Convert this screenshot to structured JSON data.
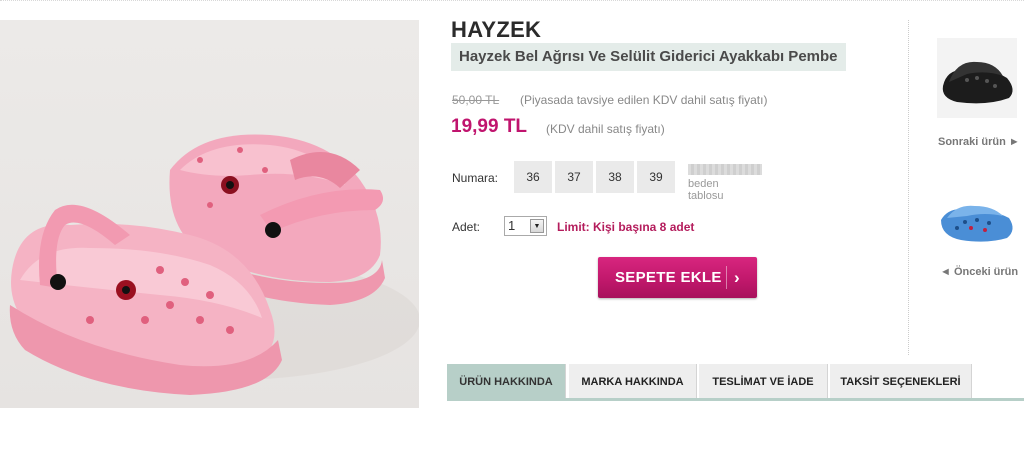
{
  "product": {
    "brand": "HAYZEK",
    "title": "Hayzek Bel Ağrısı Ve Selülit Giderici Ayakkabı Pembe",
    "old_price": "50,00 TL",
    "old_price_note": "(Piyasada tavsiye edilen KDV dahil satış fiyatı)",
    "price": "19,99 TL",
    "price_note": "(KDV dahil satış fiyatı)",
    "image_icon": "pink-clog-shoes"
  },
  "size": {
    "label": "Numara:",
    "options": [
      "36",
      "37",
      "38",
      "39"
    ],
    "size_chart_label": "beden tablosu"
  },
  "quantity": {
    "label": "Adet:",
    "value": "1",
    "limit_text": "Limit: Kişi başına 8 adet"
  },
  "cart": {
    "button_label": "SEPETE EKLE",
    "arrow_icon": "chevron-right"
  },
  "navigation": {
    "next_label": "Sonraki ürün ►",
    "prev_label": "◄ Önceki ürün"
  },
  "tabs": [
    {
      "label": "ÜRÜN HAKKINDA",
      "active": true
    },
    {
      "label": "MARKA HAKKINDA",
      "active": false
    },
    {
      "label": "TESLİMAT VE İADE",
      "active": false
    },
    {
      "label": "TAKSİT SEÇENEKLERİ",
      "active": false
    }
  ],
  "colors": {
    "price": "#c0146e",
    "cart_button": "#c1186c",
    "active_tab": "#b7cfc8",
    "title_bg": "#e4ece9"
  }
}
